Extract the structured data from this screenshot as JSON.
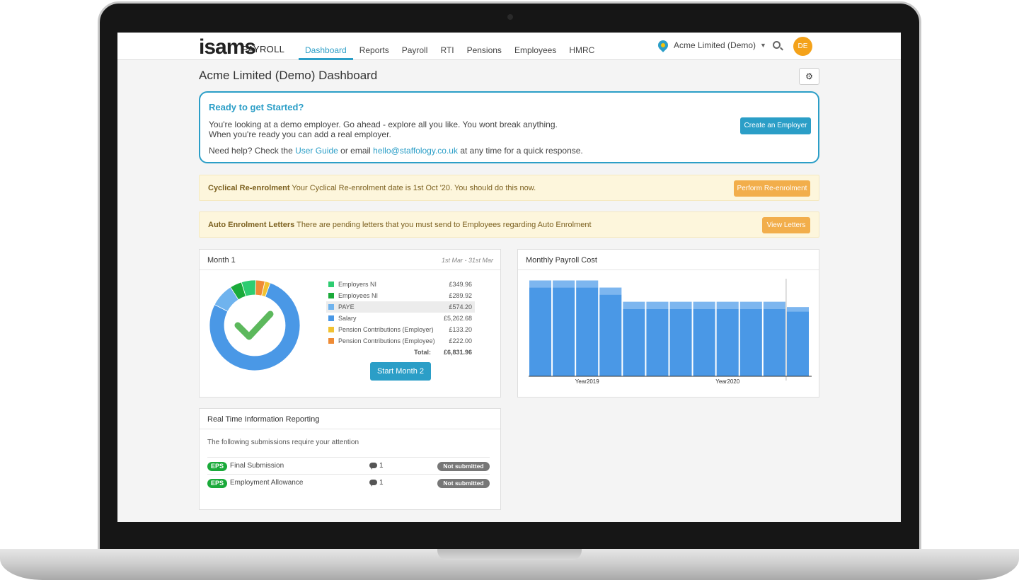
{
  "nav": {
    "logo": "isams",
    "logo_sub": "PAYROLL",
    "items": [
      {
        "label": "Dashboard",
        "active": true
      },
      {
        "label": "Reports"
      },
      {
        "label": "Payroll"
      },
      {
        "label": "RTI"
      },
      {
        "label": "Pensions"
      },
      {
        "label": "Employees"
      },
      {
        "label": "HMRC"
      }
    ],
    "employer": "Acme Limited (Demo)",
    "avatar": "DE"
  },
  "page": {
    "title": "Acme Limited (Demo) Dashboard"
  },
  "welcome": {
    "title": "Ready to get Started?",
    "line1": "You're looking at a demo employer. Go ahead - explore all you like. You wont break anything.",
    "line2": "When you're ready you can add a real employer.",
    "help_prefix": "Need help? Check the",
    "help_link": "User Guide",
    "help_mid": "or email",
    "help_email": "hello@staffology.co.uk",
    "help_suffix": "at any time for a quick response.",
    "button": "Create an Employer"
  },
  "alerts": [
    {
      "title": "Cyclical Re-enrolment",
      "text": "Your Cyclical Re-enrolment date is 1st Oct '20. You should do this now.",
      "button": "Perform Re-enrolment"
    },
    {
      "title": "Auto Enrolment Letters",
      "text": "There are pending letters that you must send to Employees regarding Auto Enrolment",
      "button": "View Letters"
    }
  ],
  "month_panel": {
    "title": "Month 1",
    "period": "1st Mar - 31st Mar",
    "total_label": "Total:",
    "total_value": "£6,831.96",
    "button": "Start Month 2"
  },
  "chart_data": [
    {
      "type": "pie",
      "title": "",
      "categories": [
        "Employers NI",
        "Employees NI",
        "PAYE",
        "Salary",
        "Pension Contributions (Employer)",
        "Pension Contributions (Employee)"
      ],
      "values": [
        349.96,
        289.92,
        574.2,
        5262.68,
        133.2,
        222.0
      ],
      "labels": [
        "£349.96",
        "£289.92",
        "£574.20",
        "£5,262.68",
        "£133.20",
        "£222.00"
      ],
      "colors": [
        "#2ecc71",
        "#1aaa3a",
        "#6fb3ee",
        "#4a98e6",
        "#f1c232",
        "#ef8b35"
      ],
      "highlighted": "PAYE",
      "total": "£6,831.96"
    },
    {
      "type": "bar",
      "title": "Monthly Payroll Cost",
      "x_tick_labels": [
        "Year2019",
        "Year2020"
      ],
      "series": [
        {
          "values": [
            100,
            100,
            100,
            92,
            76,
            76,
            76,
            76,
            76,
            76,
            76,
            73
          ]
        },
        {
          "values": [
            8,
            8,
            8,
            8,
            8,
            8,
            8,
            8,
            8,
            8,
            8,
            5
          ]
        }
      ],
      "colors": [
        "#4a98e6",
        "#7db6ef"
      ],
      "ylim": [
        0,
        110
      ]
    }
  ],
  "rti": {
    "title": "Real Time Information Reporting",
    "intro": "The following submissions require your attention",
    "rows": [
      {
        "badge": "EPS",
        "label": "Final Submission",
        "comments": "1",
        "status": "Not submitted"
      },
      {
        "badge": "EPS",
        "label": "Employment Allowance",
        "comments": "1",
        "status": "Not submitted"
      }
    ]
  }
}
